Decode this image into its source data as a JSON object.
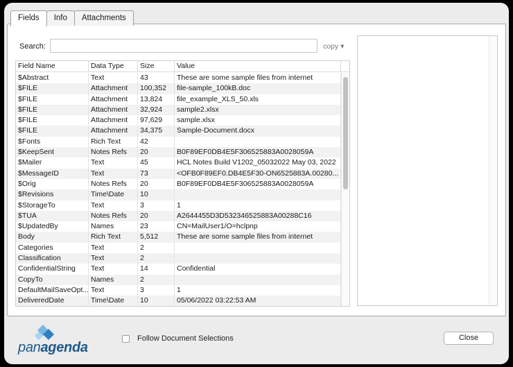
{
  "tabs": [
    {
      "label": "Fields",
      "active": true
    },
    {
      "label": "Info",
      "active": false
    },
    {
      "label": "Attachments",
      "active": false
    }
  ],
  "search": {
    "label": "Search:",
    "value": "",
    "placeholder": ""
  },
  "copy_label": "copy ▾",
  "table": {
    "headers": [
      "Field Name",
      "Data Type",
      "Size",
      "Value"
    ],
    "rows": [
      [
        "$Abstract",
        "Text",
        "43",
        "These are some sample files from internet"
      ],
      [
        "$FILE",
        "Attachment",
        "100,352",
        "file-sample_100kB.doc"
      ],
      [
        "$FILE",
        "Attachment",
        "13,824",
        "file_example_XLS_50.xls"
      ],
      [
        "$FILE",
        "Attachment",
        "32,924",
        "sample2.xlsx"
      ],
      [
        "$FILE",
        "Attachment",
        "97,629",
        "sample.xlsx"
      ],
      [
        "$FILE",
        "Attachment",
        "34,375",
        "Sample-Document.docx"
      ],
      [
        "$Fonts",
        "Rich Text",
        "42",
        ""
      ],
      [
        "$KeepSent",
        "Notes Refs",
        "20",
        "B0F89EF0DB4E5F306525883A0028059A"
      ],
      [
        "$Mailer",
        "Text",
        "45",
        "HCL Notes Build V1202_05032022 May 03, 2022"
      ],
      [
        "$MessageID",
        "Text",
        "73",
        "<OFB0F89EF0.DB4E5F30-ON6525883A.00280..."
      ],
      [
        "$Orig",
        "Notes Refs",
        "20",
        "B0F89EF0DB4E5F306525883A0028059A"
      ],
      [
        "$Revisions",
        "Time\\Date",
        "10",
        ""
      ],
      [
        "$StorageTo",
        "Text",
        "3",
        "1"
      ],
      [
        "$TUA",
        "Notes Refs",
        "20",
        "A2644455D3D532346525883A00288C16"
      ],
      [
        "$UpdatedBy",
        "Names",
        "23",
        "CN=MailUser1/O=hclpnp"
      ],
      [
        "Body",
        "Rich Text",
        "5,512",
        "These are some sample files from internet"
      ],
      [
        "Categories",
        "Text",
        "2",
        ""
      ],
      [
        "Classification",
        "Text",
        "2",
        ""
      ],
      [
        "ConfidentialString",
        "Text",
        "14",
        "Confidential"
      ],
      [
        "CopyTo",
        "Names",
        "2",
        ""
      ],
      [
        "DefaultMailSaveOpt...",
        "Text",
        "3",
        "1"
      ],
      [
        "DeliveredDate",
        "Time\\Date",
        "10",
        "05/06/2022 03:22:53 AM"
      ]
    ]
  },
  "logo": {
    "text_light": "pan",
    "text_bold": "agenda"
  },
  "follow_label": "Follow Document Selections",
  "close_label": "Close"
}
